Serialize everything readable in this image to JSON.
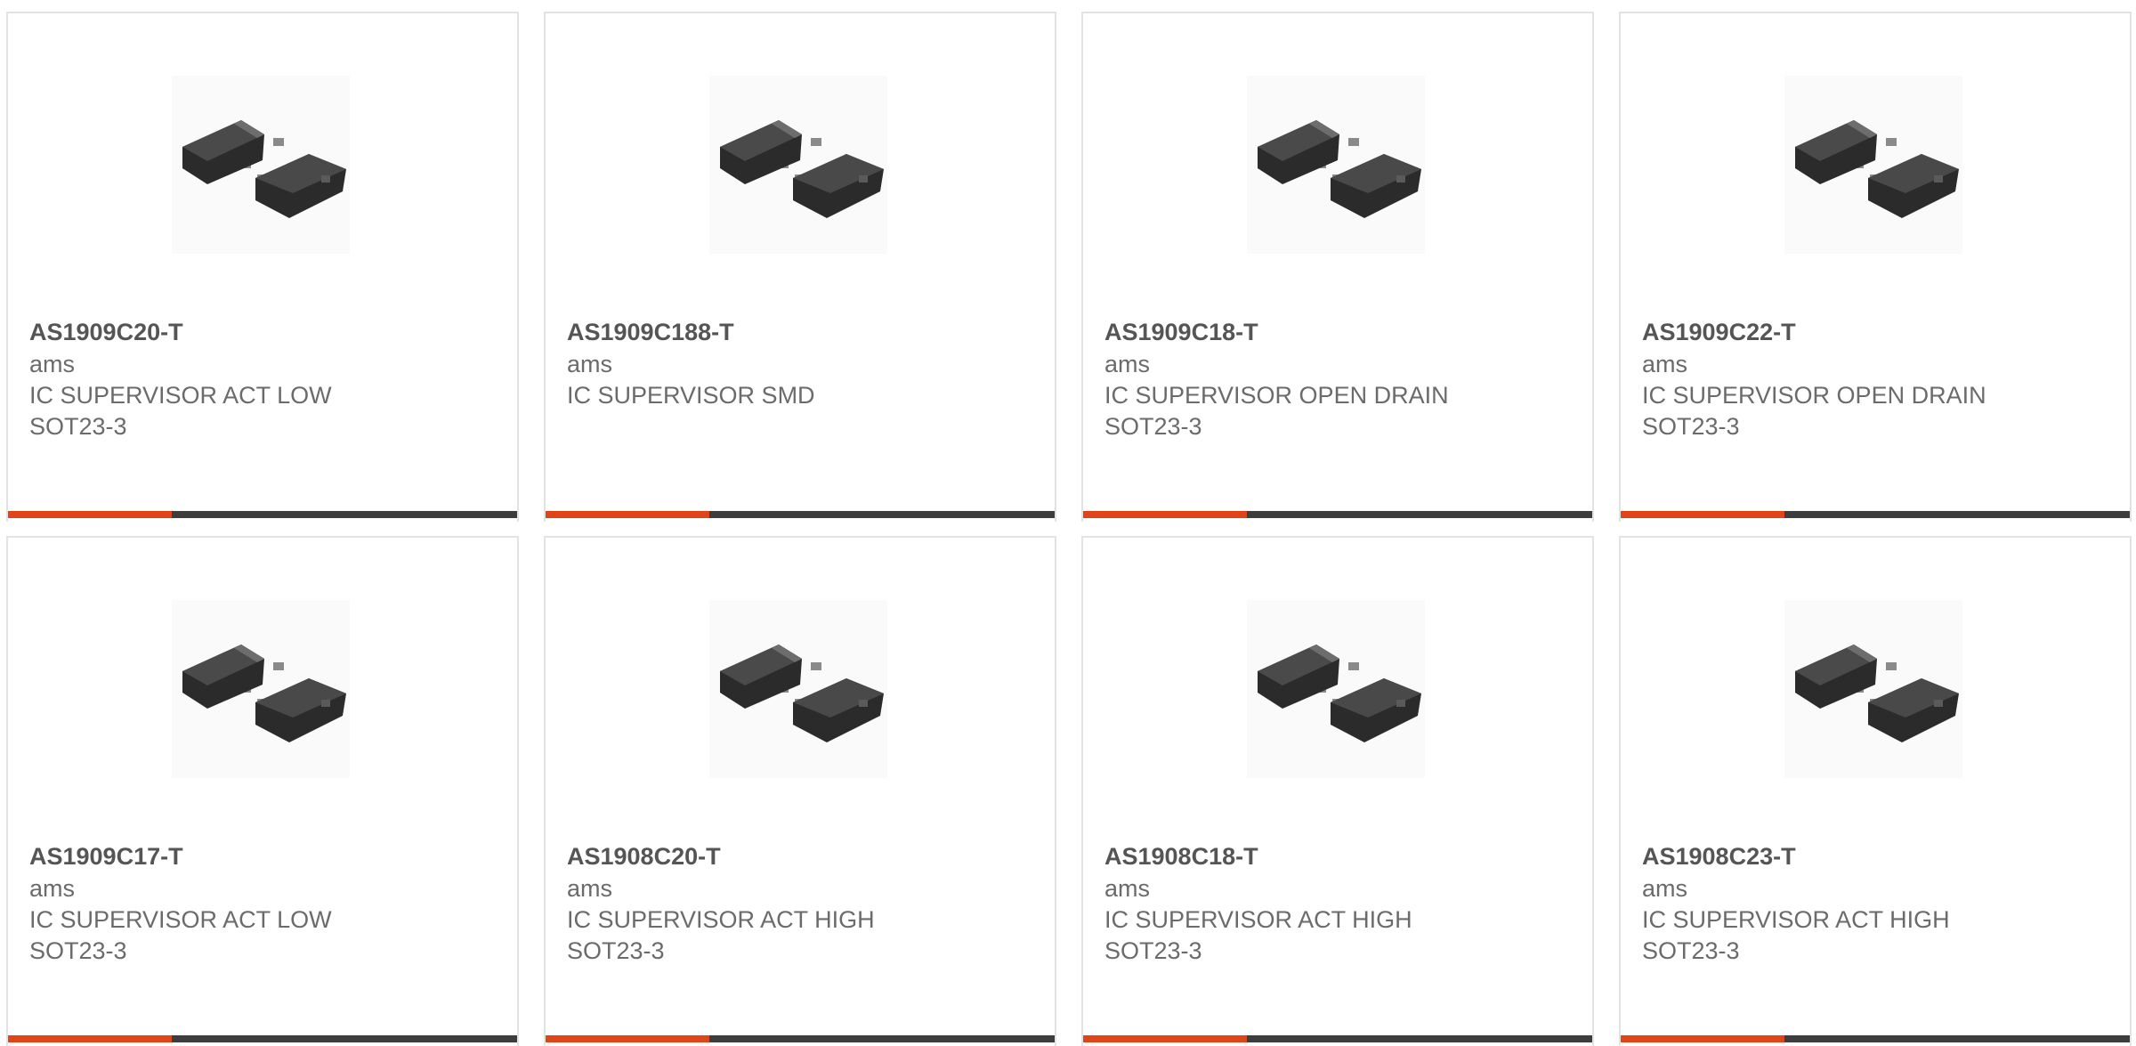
{
  "theme": {
    "accent_color": "#e0451a",
    "bar_color": "#3d3d3d",
    "border_color": "#e3e3e3"
  },
  "products": [
    {
      "part_number": "AS1909C20-T",
      "manufacturer": "ams",
      "desc_line1": "IC SUPERVISOR ACT LOW",
      "desc_line2": "SOT23-3",
      "image_icon": "sot23-3-package-icon"
    },
    {
      "part_number": "AS1909C188-T",
      "manufacturer": "ams",
      "desc_line1": "IC SUPERVISOR SMD",
      "desc_line2": "",
      "image_icon": "sot23-3-package-icon"
    },
    {
      "part_number": "AS1909C18-T",
      "manufacturer": "ams",
      "desc_line1": "IC SUPERVISOR OPEN DRAIN",
      "desc_line2": "SOT23-3",
      "image_icon": "sot23-3-package-icon"
    },
    {
      "part_number": "AS1909C22-T",
      "manufacturer": "ams",
      "desc_line1": "IC SUPERVISOR OPEN DRAIN",
      "desc_line2": "SOT23-3",
      "image_icon": "sot23-3-package-icon"
    },
    {
      "part_number": "AS1909C17-T",
      "manufacturer": "ams",
      "desc_line1": "IC SUPERVISOR ACT LOW",
      "desc_line2": "SOT23-3",
      "image_icon": "sot23-3-package-icon"
    },
    {
      "part_number": "AS1908C20-T",
      "manufacturer": "ams",
      "desc_line1": "IC SUPERVISOR ACT HIGH",
      "desc_line2": "SOT23-3",
      "image_icon": "sot23-3-package-icon"
    },
    {
      "part_number": "AS1908C18-T",
      "manufacturer": "ams",
      "desc_line1": "IC SUPERVISOR ACT HIGH",
      "desc_line2": "SOT23-3",
      "image_icon": "sot23-3-package-icon"
    },
    {
      "part_number": "AS1908C23-T",
      "manufacturer": "ams",
      "desc_line1": "IC SUPERVISOR ACT HIGH",
      "desc_line2": "SOT23-3",
      "image_icon": "sot23-3-package-icon"
    }
  ]
}
